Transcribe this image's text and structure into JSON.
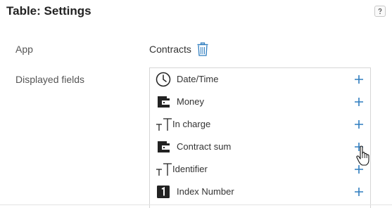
{
  "panel": {
    "title": "Table: Settings",
    "help_icon": "help-icon"
  },
  "app_row": {
    "label": "App",
    "value": "Contracts",
    "delete_icon": "trash-icon"
  },
  "fields_row": {
    "label": "Displayed fields",
    "items": [
      {
        "label": "Date/Time",
        "icon": "clock-icon"
      },
      {
        "label": "Money",
        "icon": "wallet-icon"
      },
      {
        "label": "In charge",
        "icon": "text-type-icon"
      },
      {
        "label": "Contract sum",
        "icon": "wallet-icon"
      },
      {
        "label": "Identifier",
        "icon": "text-type-icon"
      },
      {
        "label": "Index Number",
        "icon": "number-one-icon"
      }
    ]
  },
  "colors": {
    "accent": "#2f7dbf",
    "icon_dark": "#222222"
  }
}
